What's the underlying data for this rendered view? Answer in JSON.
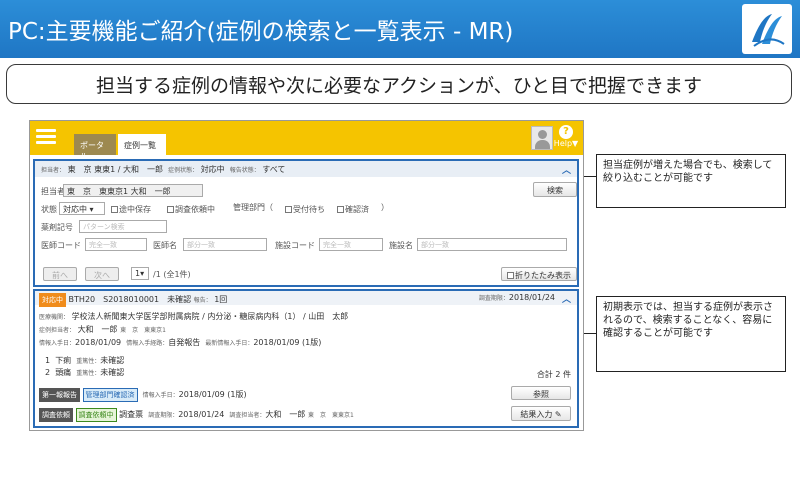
{
  "header": {
    "title": "PC:主要機能ご紹介(症例の検索と一覧表示 - MR)"
  },
  "subtitle": "担当する症例の情報や次に必要なアクションが、ひと目で把握できます",
  "app": {
    "tabs": [
      "ポータル",
      "症例一覧"
    ],
    "help_label": "Help▼",
    "summary": {
      "tantou_lbl": "担当者：",
      "tantou_val": "東　京 東東1 / 大和　一郎",
      "status_lbl": "症例状態：",
      "status_val": "対応中",
      "report_lbl": "報告状態：",
      "report_val": "すべて"
    },
    "search": {
      "tantou_label": "担当者",
      "tantou_value": "東　京　東東京1 大和　一郎",
      "search_button": "検索",
      "status_label": "状態",
      "status_value": "対応中 ▾",
      "chk_pause": "途中保存",
      "chk_investigate": "調査依頼中",
      "mgmt_label": "管理部門（",
      "chk_received": "受付待ち",
      "chk_confirmed": "確認済",
      "mgmt_close": "）",
      "drug_label": "薬剤記号",
      "drug_placeholder": "パターン検索",
      "doctor_code_label": "医師コード",
      "doctor_code_placeholder": "完全一致",
      "doctor_name_label": "医師名",
      "doctor_name_placeholder": "部分一致",
      "facility_code_label": "施設コード",
      "facility_code_placeholder": "完全一致",
      "facility_name_label": "施設名",
      "facility_name_placeholder": "部分一致",
      "prev_button": "前へ",
      "next_button": "次へ",
      "page_select": "1▾",
      "page_info": "/1 (全1件)",
      "fold_label": "折りたたみ表示"
    },
    "result": {
      "status_badge": "対応中",
      "case_id": "BTH20　S2018010001　未確認",
      "report_lbl": "報告：",
      "report_val": "1回",
      "due_lbl": "調査期限：",
      "due_val": "2018/01/24",
      "institution_lbl": "医療機関：",
      "institution_val": "学校法人新聞東大学医学部附属病院 / 内分泌・糖尿病内科（1） / 山田　太郎",
      "case_tantou_lbl": "症例担当者：",
      "case_tantou_val": "大和　一郎",
      "case_tantou_dept": "東　京　東東京1",
      "info_date_lbl": "情報入手日：",
      "info_date_val": "2018/01/09",
      "info_route_lbl": "情報入手経路：",
      "info_route_val": "自発報告",
      "latest_date_lbl": "最新情報入手日：",
      "latest_date_val": "2018/01/09 (1版)",
      "event1_no": "1",
      "event1_name": "下痢",
      "event1_lbl": "重篤性：",
      "event1_val": "未確認",
      "event2_no": "2",
      "event2_name": "頭痛",
      "event2_lbl": "重篤性：",
      "event2_val": "未確認",
      "total": "合計 2 件",
      "first_report_badge": "第一報報告",
      "mgmt_confirm_badge": "管理部門確認済",
      "first_info_lbl": "情報入手日：",
      "first_info_val": "2018/01/09 (1版)",
      "ref_button": "参照",
      "investigate_badge": "調査依頼",
      "investigating_badge": "調査依頼中",
      "survey_label": "調査票",
      "survey_due_lbl": "調査期限：",
      "survey_due_val": "2018/01/24",
      "survey_tantou_lbl": "調査担当者：",
      "survey_tantou_val": "大和　一郎",
      "survey_tantou_dept": "東　京　東東京1",
      "result_input_button": "結果入力"
    }
  },
  "callouts": {
    "search_note": "担当症例が増えた場合でも、検索して絞り込むことが可能です",
    "list_note": "初期表示では、担当する症例が表示されるので、検索することなく、容易に確認することが可能です"
  }
}
